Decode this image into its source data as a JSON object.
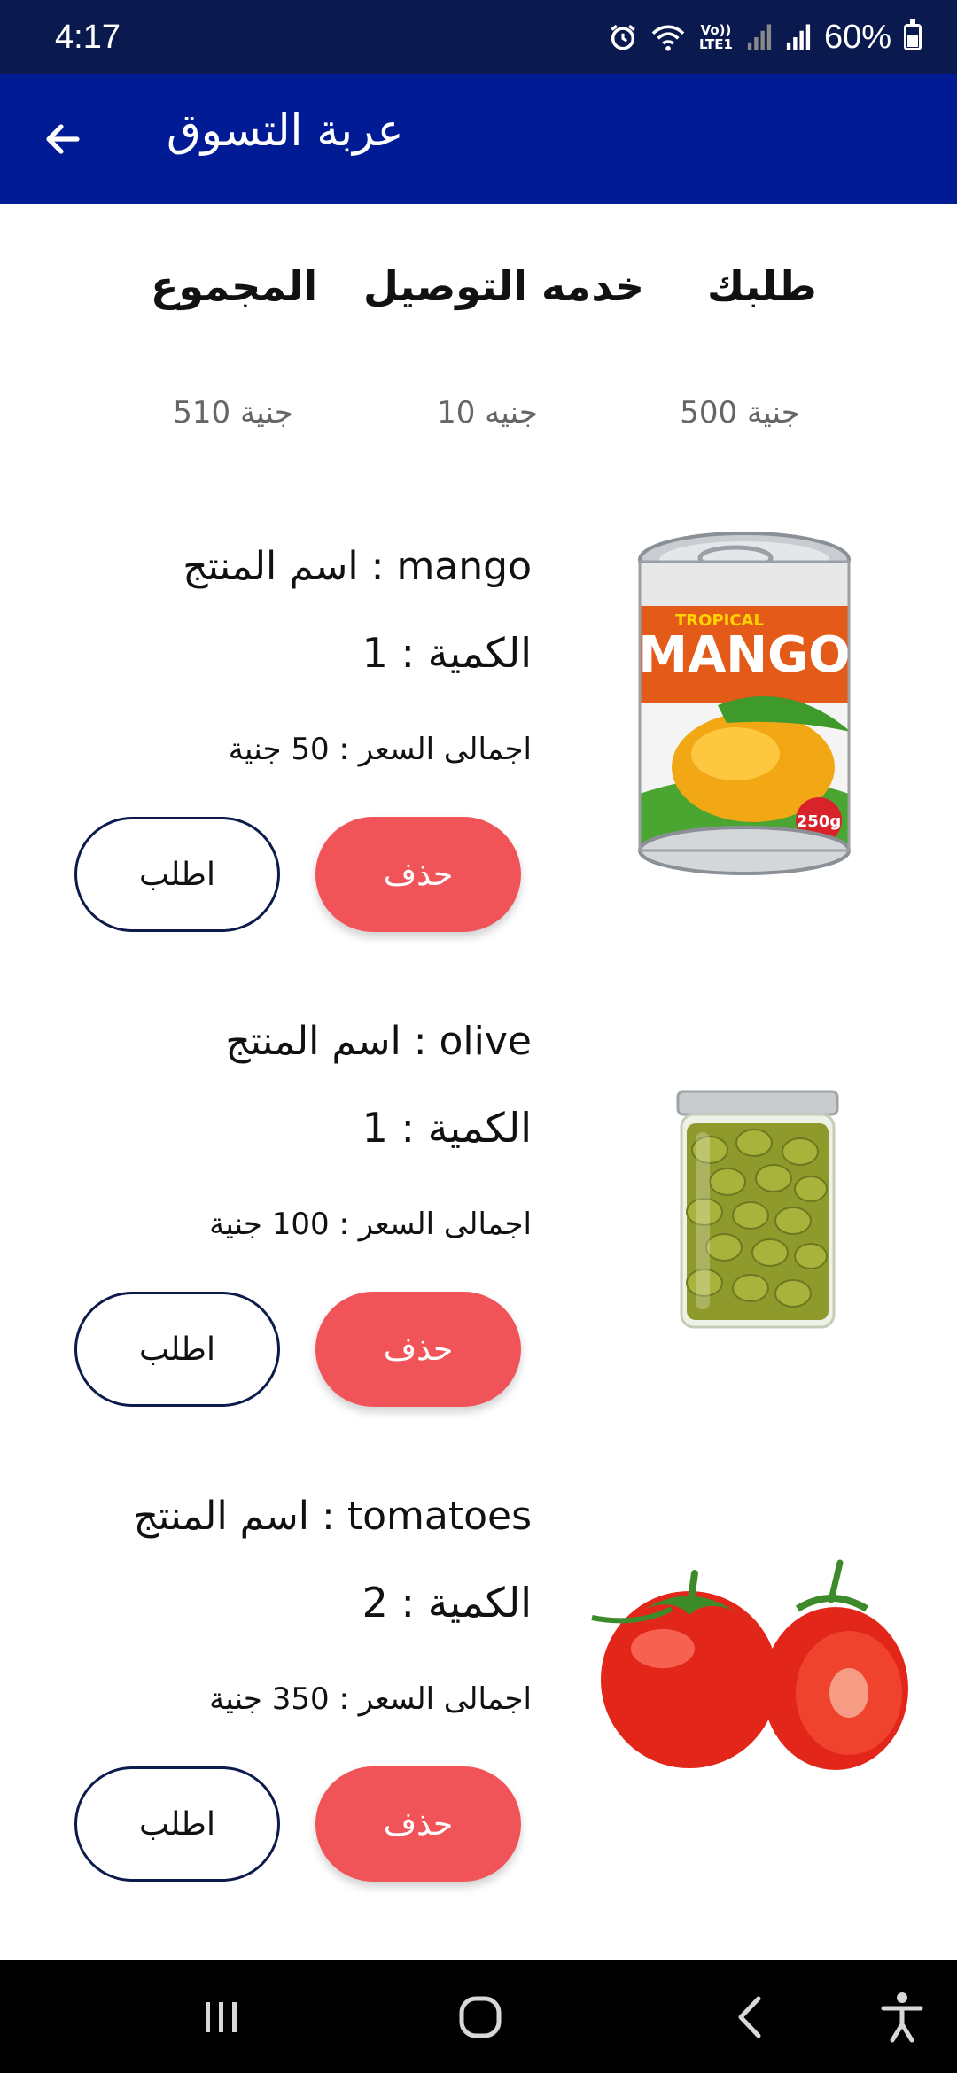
{
  "status_bar": {
    "time": "4:17",
    "lte_label": "Vo)) LTE1",
    "battery": "60%",
    "icons": [
      "alarm-icon",
      "wifi-icon",
      "lte-icon",
      "signal-icon",
      "signal-icon",
      "battery-icon"
    ]
  },
  "app_bar": {
    "title": "عربة التسوق",
    "back_icon": "arrow-left-icon"
  },
  "summary": {
    "headers": {
      "order": "طلبك",
      "delivery": "خدمه التوصيل",
      "total": "المجموع"
    },
    "values": {
      "order": "500 جنية",
      "delivery": "10 جنيه",
      "total": "510 جنية"
    }
  },
  "items": [
    {
      "name_line": "اسم المنتج : mango",
      "qty_line": "الكمية : 1",
      "price_line": "اجمالى السعر : 50 جنية",
      "image": {
        "label_top": "TROPICAL",
        "label_main": "MANGO",
        "label_weight": "250g"
      }
    },
    {
      "name_line": "اسم المنتج : olive",
      "qty_line": "الكمية : 1",
      "price_line": "اجمالى السعر : 100 جنية"
    },
    {
      "name_line": "اسم المنتج : tomatoes",
      "qty_line": "الكمية : 2",
      "price_line": "اجمالى السعر : 350 جنية"
    }
  ],
  "buttons": {
    "delete": "حذف",
    "order": "اطلب"
  },
  "colors": {
    "status_bar": "#0a1a4f",
    "app_bar": "#001b94",
    "delete_button": "#f05458",
    "order_border": "#0d1b4c"
  },
  "nav_bar": {
    "icons": [
      "recents-icon",
      "home-icon",
      "back-icon",
      "accessibility-icon"
    ]
  }
}
